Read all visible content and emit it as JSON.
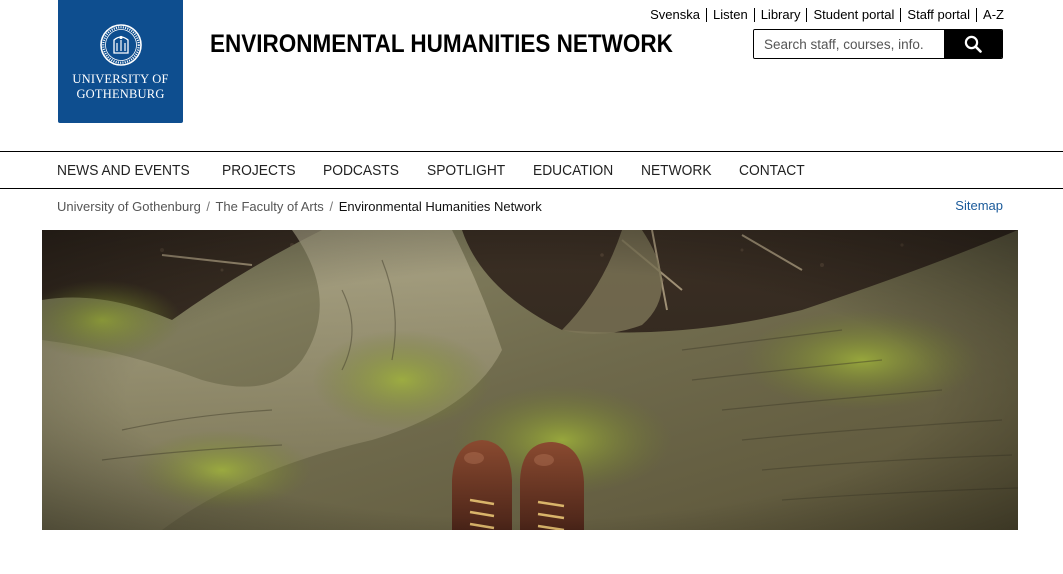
{
  "logo": {
    "line1": "UNIVERSITY OF",
    "line2": "GOTHENBURG",
    "color": "#0e4e8f"
  },
  "site_title": "ENVIRONMENTAL HUMANITIES NETWORK",
  "top_links": [
    "Svenska",
    "Listen",
    "Library",
    "Student portal",
    "Staff portal",
    "A-Z"
  ],
  "search": {
    "placeholder": "Search staff, courses, info.",
    "icon": "search-icon"
  },
  "nav": [
    "NEWS AND EVENTS",
    "PROJECTS",
    "PODCASTS",
    "SPOTLIGHT",
    "EDUCATION",
    "NETWORK",
    "CONTACT"
  ],
  "breadcrumb": {
    "items": [
      "University of Gothenburg",
      "The Faculty of Arts"
    ],
    "separator": "/",
    "current": "Environmental Humanities Network"
  },
  "sitemap": "Sitemap",
  "colors": {
    "brand_blue": "#0e4e8f",
    "link_blue": "#1a5a9a"
  }
}
